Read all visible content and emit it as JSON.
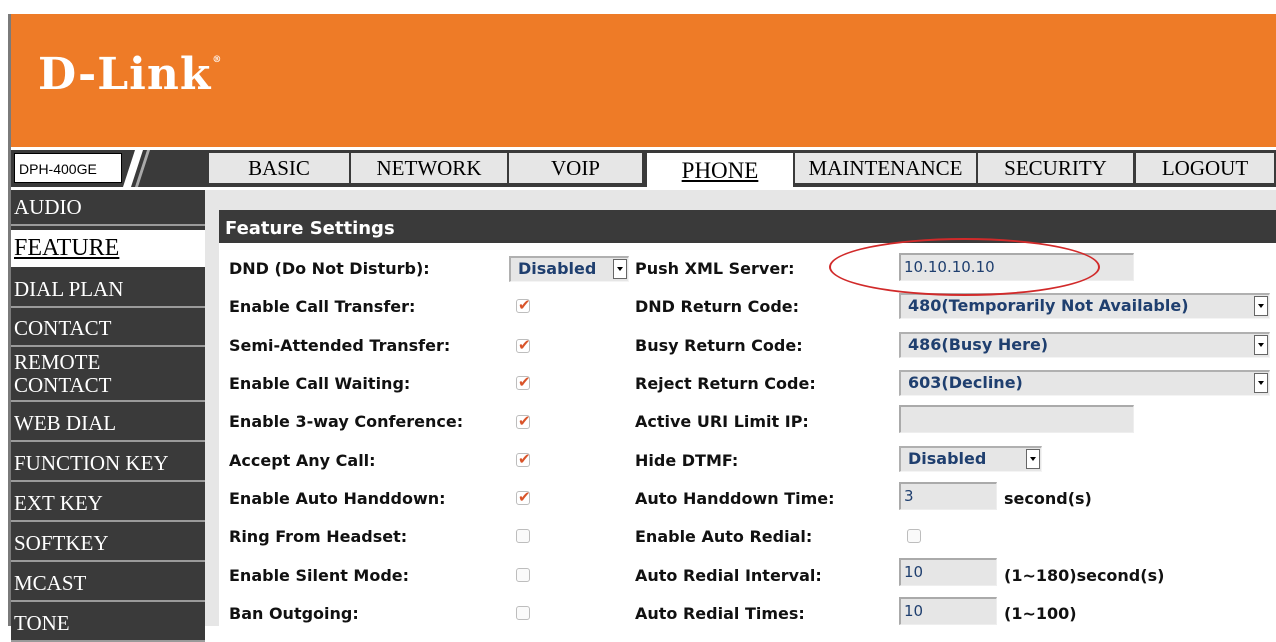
{
  "brand": {
    "logo": "D-Link",
    "model": "DPH-400GE"
  },
  "nav": {
    "tabs": [
      {
        "label": "BASIC"
      },
      {
        "label": "NETWORK"
      },
      {
        "label": "VOIP"
      },
      {
        "label": "PHONE"
      },
      {
        "label": "MAINTENANCE"
      },
      {
        "label": "SECURITY"
      },
      {
        "label": "LOGOUT"
      }
    ],
    "active": "PHONE"
  },
  "sidebar": {
    "items": [
      {
        "label": "AUDIO"
      },
      {
        "label": "FEATURE"
      },
      {
        "label": "DIAL PLAN"
      },
      {
        "label": "CONTACT"
      },
      {
        "label": "REMOTE CONTACT",
        "line1": "REMOTE",
        "line2": "CONTACT"
      },
      {
        "label": "WEB DIAL"
      },
      {
        "label": "FUNCTION KEY"
      },
      {
        "label": "EXT KEY"
      },
      {
        "label": "SOFTKEY"
      },
      {
        "label": "MCAST"
      },
      {
        "label": "TONE"
      }
    ],
    "active": "FEATURE"
  },
  "panel": {
    "title": "Feature Settings"
  },
  "left_settings": [
    {
      "label": "DND (Do Not Disturb):",
      "type": "select",
      "value": "Disabled"
    },
    {
      "label": "Enable Call Transfer:",
      "type": "checkbox",
      "checked": true
    },
    {
      "label": "Semi-Attended Transfer:",
      "type": "checkbox",
      "checked": true
    },
    {
      "label": "Enable Call Waiting:",
      "type": "checkbox",
      "checked": true
    },
    {
      "label": "Enable 3-way Conference:",
      "type": "checkbox",
      "checked": true
    },
    {
      "label": "Accept Any Call:",
      "type": "checkbox",
      "checked": true
    },
    {
      "label": "Enable Auto Handdown:",
      "type": "checkbox",
      "checked": true
    },
    {
      "label": "Ring From Headset:",
      "type": "checkbox",
      "checked": false
    },
    {
      "label": "Enable Silent Mode:",
      "type": "checkbox",
      "checked": false
    },
    {
      "label": "Ban Outgoing:",
      "type": "checkbox",
      "checked": false
    }
  ],
  "right_settings": [
    {
      "label": "Push XML Server:",
      "type": "input",
      "value": "10.10.10.10"
    },
    {
      "label": "DND Return Code:",
      "type": "select",
      "value": "480(Temporarily Not Available)"
    },
    {
      "label": "Busy Return Code:",
      "type": "select",
      "value": "486(Busy Here)"
    },
    {
      "label": "Reject Return Code:",
      "type": "select",
      "value": "603(Decline)"
    },
    {
      "label": "Active URI Limit IP:",
      "type": "input",
      "value": ""
    },
    {
      "label": "Hide DTMF:",
      "type": "select",
      "value": "Disabled"
    },
    {
      "label": "Auto Handdown Time:",
      "type": "input",
      "value": "3",
      "unit": "second(s)"
    },
    {
      "label": "Enable Auto Redial:",
      "type": "checkbox",
      "checked": false
    },
    {
      "label": "Auto Redial Interval:",
      "type": "input",
      "value": "10",
      "unit": "(1~180)second(s)"
    },
    {
      "label": "Auto Redial Times:",
      "type": "input",
      "value": "10",
      "unit": "(1~100)"
    }
  ],
  "icons": {
    "check": "checkmark-icon",
    "dropdown": "dropdown-arrow-icon"
  },
  "colors": {
    "header": "#ee7b27",
    "nav_bar": "#3a3a3a",
    "value_text": "#1f3f6f",
    "check": "#d9542a",
    "highlight_oval": "#d12a2a"
  }
}
